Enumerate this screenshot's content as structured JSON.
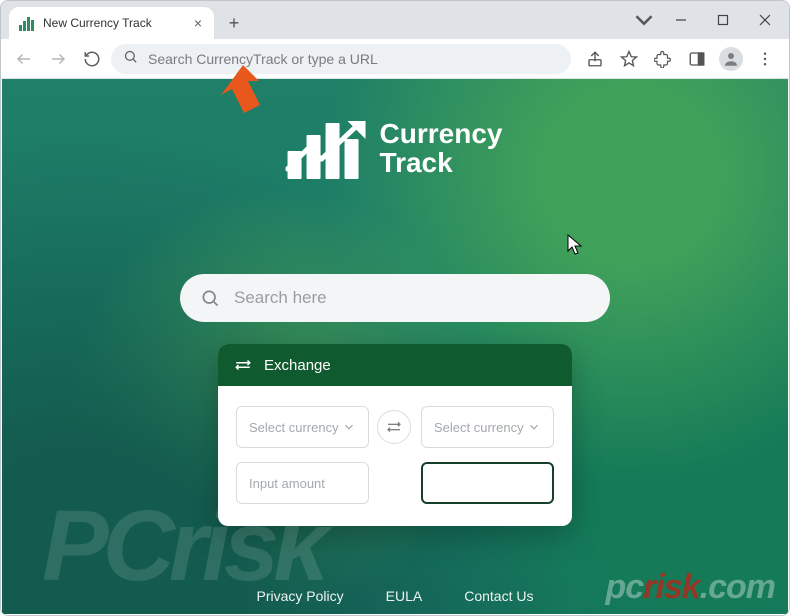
{
  "browser": {
    "tab_title": "New Currency Track",
    "omnibox_placeholder": "Search CurrencyTrack or type a URL"
  },
  "brand": {
    "line1": "Currency",
    "line2": "Track"
  },
  "search": {
    "placeholder": "Search here"
  },
  "exchange": {
    "title": "Exchange",
    "from_placeholder": "Select currency",
    "to_placeholder": "Select currency",
    "amount_placeholder": "Input amount",
    "result_value": ""
  },
  "footer": {
    "privacy": "Privacy Policy",
    "eula": "EULA",
    "contact": "Contact Us"
  },
  "watermark": {
    "text_pc": "pc",
    "text_risk": "risk",
    "text_com": ".com"
  },
  "colors": {
    "accent_green": "#0f5a2e",
    "page_bg": "#1a7a67",
    "arrow": "#e8571b"
  }
}
